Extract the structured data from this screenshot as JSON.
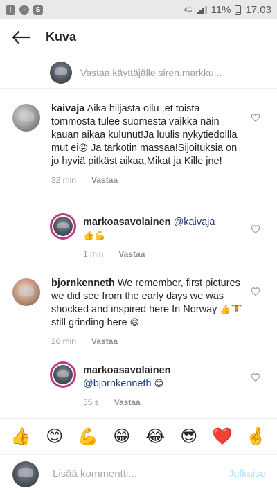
{
  "status": {
    "network": "4G",
    "battery": "11%",
    "time": "17.03",
    "left_icons": [
      "!",
      "messenger-icon",
      "S"
    ]
  },
  "header": {
    "title": "Kuva"
  },
  "reply_bar": {
    "text": "Vastaa käyttäjälle siren.markku..."
  },
  "comments": [
    {
      "user": "kaivaja",
      "text": "Aika hiljasta ollu ,et toista tommosta tulee suomesta vaikka näin kauan aikaa kulunut!Ja luulis nykytiedoilla mut ei",
      "text_after_emoji": " Ja tarkotin massaa!Sijoituksia on jo hyviä pitkäst aikaa,Mikat ja Kille jne!",
      "emoji": "😜",
      "time": "32 min",
      "reply": "Vastaa"
    },
    {
      "user": "markoasavolainen",
      "mention": "@kaivaja",
      "emojis": "👍💪",
      "time": "1 min",
      "reply": "Vastaa"
    },
    {
      "user": "bjornkenneth",
      "text": "We remember, first pictures we did see from the early days we was shocked and inspired here In Norway ",
      "emojis_mid": "👍🏋",
      "text_after": " still grinding here ",
      "emoji_end": "😄",
      "time": "26 min",
      "reply": "Vastaa"
    },
    {
      "user": "markoasavolainen",
      "mention": "@bjornkenneth",
      "emoji": "😊",
      "time": "55 s",
      "reply": "Vastaa"
    }
  ],
  "emoji_bar": [
    "👍",
    "😊",
    "💪",
    "😁",
    "😂",
    "😎",
    "❤️",
    "🤞"
  ],
  "comment_input": {
    "placeholder": "Lisää kommentti...",
    "post_label": "Julkaisu"
  },
  "colors": {
    "mention": "#1f3f74",
    "post_disabled": "#b2dffc",
    "ring": "#c13584"
  }
}
